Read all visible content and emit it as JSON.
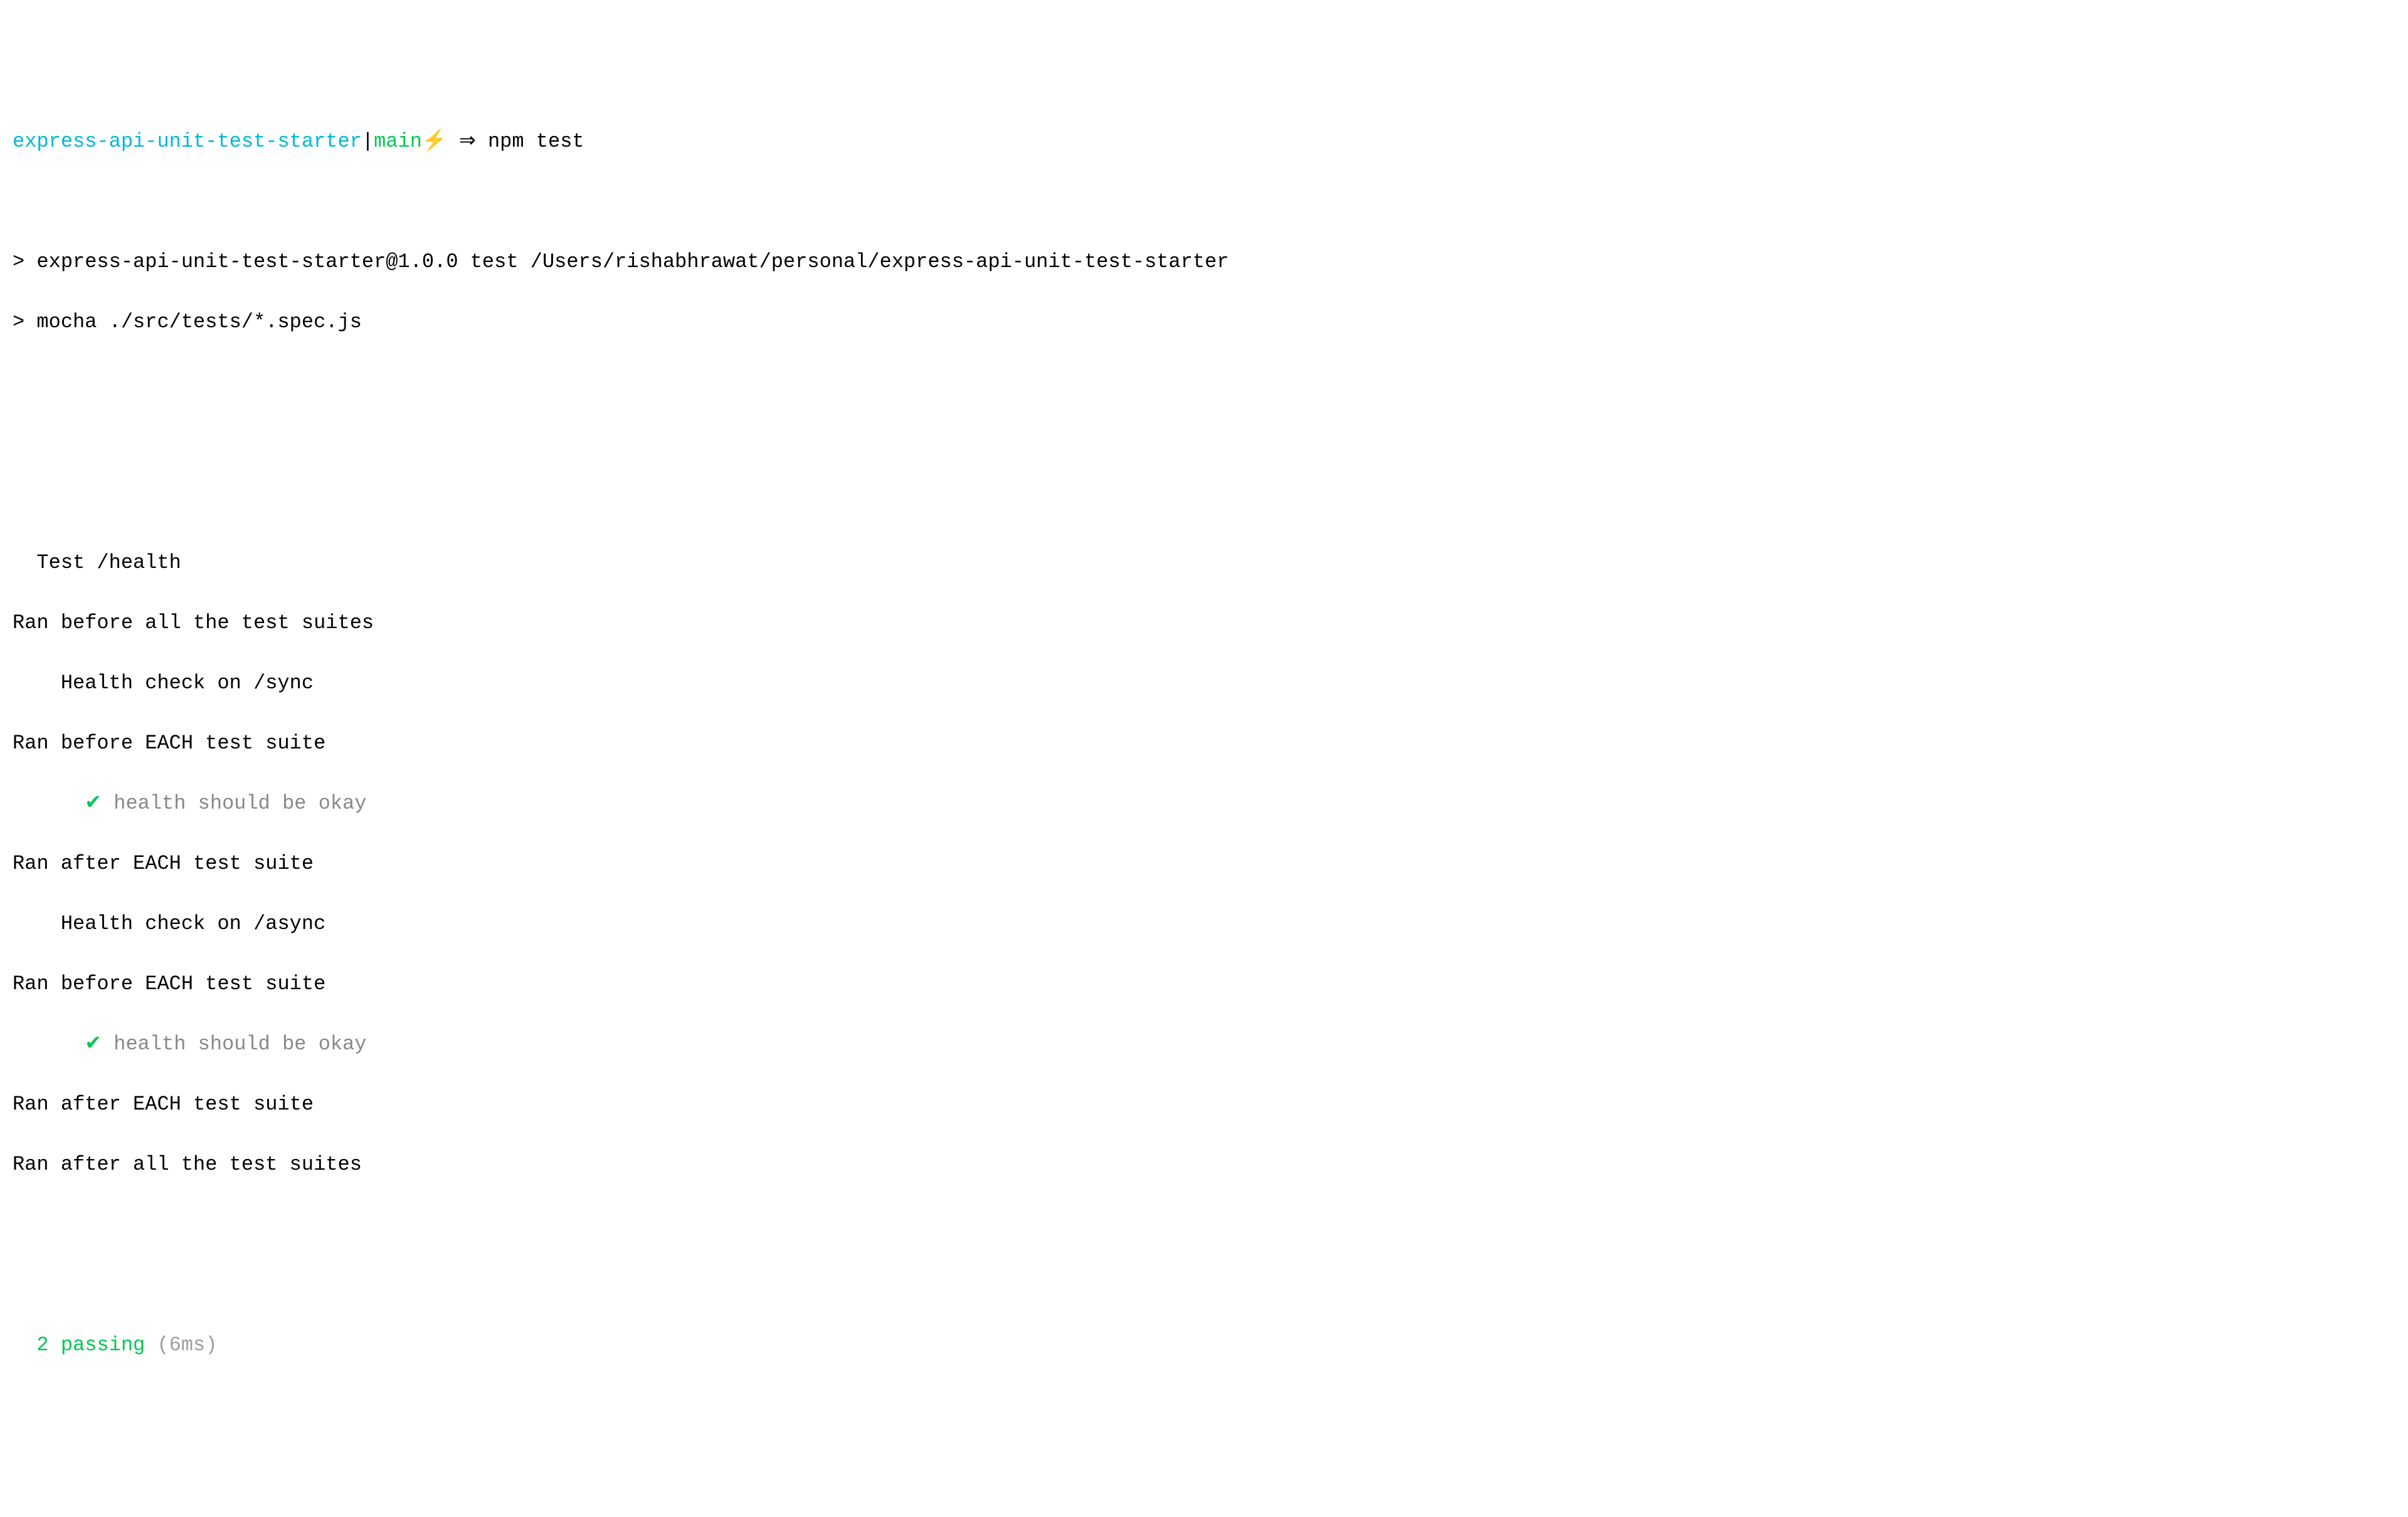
{
  "prompt": {
    "project": "express-api-unit-test-starter",
    "pipe": "|",
    "branch": "main",
    "lightning": "⚡",
    "arrow": "⇒",
    "command": "npm test"
  },
  "npm_output": {
    "line1_prefix": "> ",
    "line1": "express-api-unit-test-starter@1.0.0 test /Users/rishabhrawat/personal/express-api-unit-test-starter",
    "line2_prefix": "> ",
    "line2": "mocha ./src/tests/*.spec.js"
  },
  "test_output": {
    "suite_title": "  Test /health",
    "before_all": "Ran before all the test suites",
    "context1_title": "    Health check on /sync",
    "before_each_1": "Ran before EACH test suite",
    "check1": "✔",
    "test1_text": " health should be okay",
    "test1_indent": "      ",
    "after_each_1": "Ran after EACH test suite",
    "context2_title": "    Health check on /async",
    "before_each_2": "Ran before EACH test suite",
    "check2": "✔",
    "test2_text": " health should be okay",
    "test2_indent": "      ",
    "after_each_2": "Ran after EACH test suite",
    "after_all": "Ran after all the test suites"
  },
  "summary": {
    "indent": "  ",
    "passing": "2 passing",
    "duration": " (6ms)"
  }
}
